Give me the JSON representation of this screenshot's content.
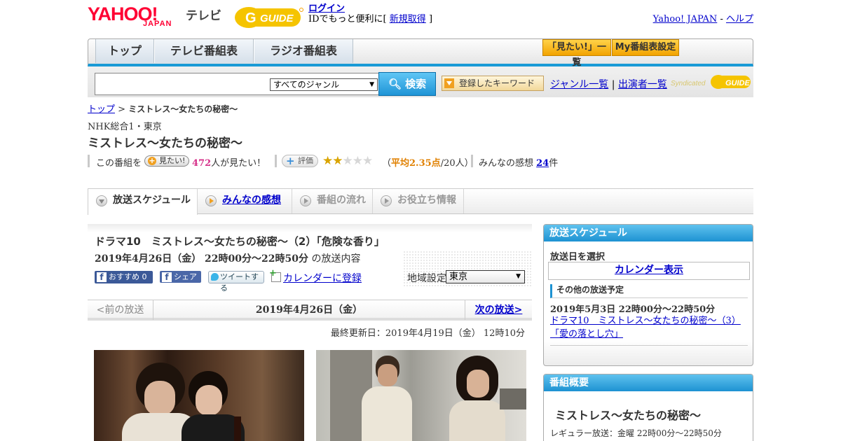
{
  "header": {
    "logo_yahoo": "YAHOO!",
    "logo_japan": "JAPAN",
    "logo_tv": "テレビ",
    "logo_gguide": "G-GUIDE",
    "login": "ログイン",
    "login_sub_prefix": "IDでもっと便利に[",
    "signup": "新規取得",
    "login_sub_suffix": "]",
    "yahoo_japan_link": "Yahoo! JAPAN",
    "sep": "-",
    "help_link": "ヘルプ"
  },
  "nav": {
    "tabs": [
      "トップ",
      "テレビ番組表",
      "ラジオ番組表"
    ],
    "mitai_list": "「見たい!」一覧",
    "my_bangumi": "My番組表設定"
  },
  "search": {
    "genre": "すべてのジャンル",
    "button": "検索",
    "keyword_button": "登録したキーワード",
    "genre_list": "ジャンル一覧",
    "divider": "|",
    "performer_list": "出演者一覧",
    "syndicated": "Syndicated"
  },
  "breadcrumb": {
    "home": "トップ",
    "sep": ">",
    "current": "ミストレス～女たちの秘密～"
  },
  "program": {
    "channel": "NHK総合1・東京",
    "title": "ミストレス～女たちの秘密～"
  },
  "rating": {
    "mitai_prefix": "この番組を",
    "mitai_button": "見たい!",
    "mitai_count": "472",
    "mitai_suffix": "人が見たい！",
    "hyoka_button": "評価",
    "stars_value": 2.35,
    "stars_max": 5,
    "avg_open": "（",
    "avg_text": "平均2.35点",
    "avg_people": "/20人）",
    "kansou_prefix": "みんなの感想",
    "kansou_count": "24",
    "kansou_suffix": "件"
  },
  "sub_tabs": [
    "放送スケジュール",
    "みんなの感想",
    "番組の流れ",
    "お役立ち情報"
  ],
  "episode": {
    "title": "ドラマ10　ミストレス～女たちの秘密～（2）「危険な香り」",
    "date": "2019年4月26日（金）  22時00分～22時50分",
    "date_suffix": " の放送内容",
    "fb_recommend": "おすすめ 0",
    "fb_share": "シェア",
    "tweet": "ツイートする",
    "calendar": "カレンダーに登録",
    "region_label": "地域設定",
    "region_value": "東京"
  },
  "pager": {
    "prev": "<前の放送",
    "date": "2019年4月26日（金）",
    "next": "次の放送>"
  },
  "updated": "最終更新日：2019年4月19日（金）  12時10分",
  "side_schedule": {
    "header": "放送スケジュール",
    "pick_date": "放送日を選択",
    "calendar": "カレンダー表示",
    "other_header": "その他の放送予定",
    "other_date": "2019年5月3日  22時00分～22時50分",
    "other_link": "ドラマ10　ミストレス～女たちの秘密～（3）「愛の落とし穴」"
  },
  "side_overview": {
    "header": "番組概要",
    "title": "ミストレス～女たちの秘密～",
    "regular": "レギュラー放送：金曜 22時00分～22時50分"
  },
  "colors": {
    "accent_blue": "#1d92d2",
    "yahoo_red": "#ff0033",
    "star_gold": "#d9a400",
    "pink_count": "#d6338b"
  }
}
